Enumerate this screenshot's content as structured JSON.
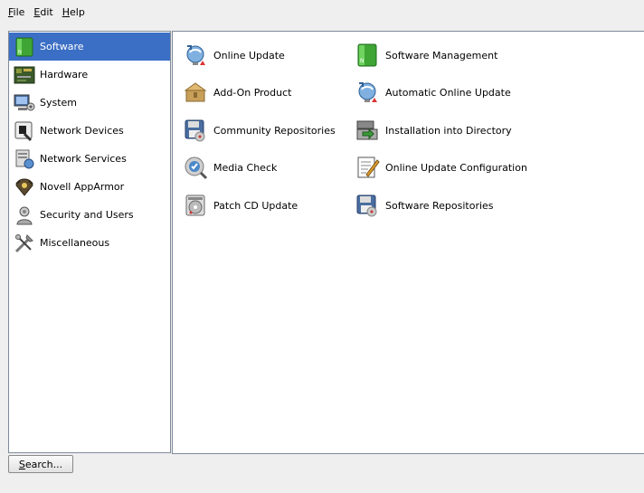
{
  "menu": {
    "file": {
      "mnemonic": "F",
      "rest": "ile"
    },
    "edit": {
      "mnemonic": "E",
      "rest": "dit"
    },
    "help": {
      "mnemonic": "H",
      "rest": "elp"
    }
  },
  "sidebar": {
    "selected_color": "#3b6fc5",
    "items": [
      {
        "label": "Software",
        "icon": "software-icon",
        "selected": true
      },
      {
        "label": "Hardware",
        "icon": "hardware-icon"
      },
      {
        "label": "System",
        "icon": "system-icon"
      },
      {
        "label": "Network Devices",
        "icon": "network-devices-icon"
      },
      {
        "label": "Network Services",
        "icon": "network-services-icon"
      },
      {
        "label": "Novell AppArmor",
        "icon": "apparmor-icon"
      },
      {
        "label": "Security and Users",
        "icon": "security-users-icon"
      },
      {
        "label": "Miscellaneous",
        "icon": "miscellaneous-icon"
      }
    ]
  },
  "modules": [
    {
      "label": "Online Update",
      "icon": "online-update-icon"
    },
    {
      "label": "Software Management",
      "icon": "software-management-icon"
    },
    {
      "label": "Add-On Product",
      "icon": "addon-product-icon"
    },
    {
      "label": "Automatic Online Update",
      "icon": "automatic-online-update-icon"
    },
    {
      "label": "Community Repositories",
      "icon": "community-repositories-icon"
    },
    {
      "label": "Installation into Directory",
      "icon": "installation-into-directory-icon"
    },
    {
      "label": "Media Check",
      "icon": "media-check-icon"
    },
    {
      "label": "Online Update Configuration",
      "icon": "online-update-configuration-icon"
    },
    {
      "label": "Patch CD Update",
      "icon": "patch-cd-update-icon"
    },
    {
      "label": "Software Repositories",
      "icon": "software-repositories-icon"
    }
  ],
  "search_button": {
    "mnemonic": "S",
    "rest": "earch..."
  }
}
